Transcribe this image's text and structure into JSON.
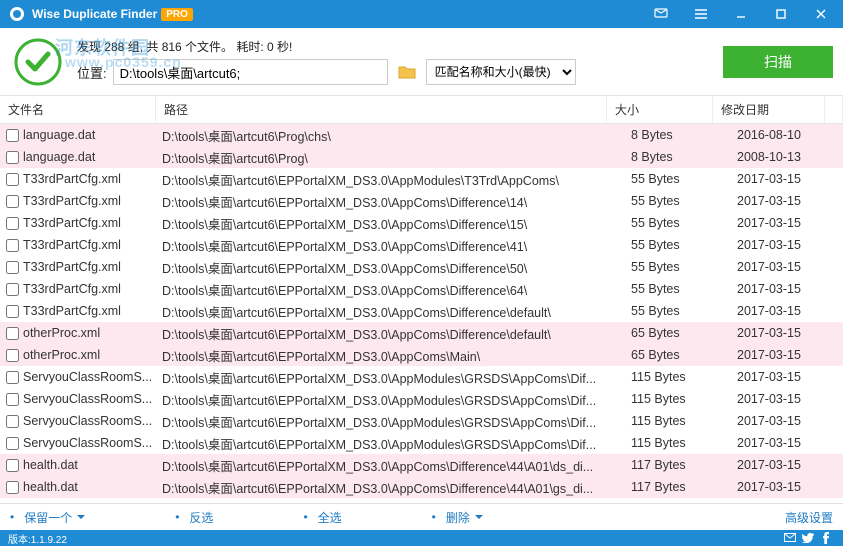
{
  "app": {
    "title": "Wise Duplicate Finder",
    "pro": "PRO"
  },
  "header": {
    "status": "发现 288 组, 共 816 个文件。 耗时: 0 秒!",
    "watermark1": "河东软件园",
    "watermark2": "www.pc0359.cn",
    "loc_label": "位置:",
    "loc_value": "D:\\tools\\桌面\\artcut6;",
    "match_mode": "匹配名称和大小(最快)",
    "scan": "扫描"
  },
  "columns": {
    "name": "文件名",
    "path": "路径",
    "size": "大小",
    "date": "修改日期"
  },
  "rows": [
    {
      "alt": true,
      "name": "language.dat",
      "path": "D:\\tools\\桌面\\artcut6\\Prog\\chs\\",
      "size": "8 Bytes",
      "date": "2016-08-10"
    },
    {
      "alt": true,
      "name": "language.dat",
      "path": "D:\\tools\\桌面\\artcut6\\Prog\\",
      "size": "8 Bytes",
      "date": "2008-10-13"
    },
    {
      "alt": false,
      "name": "T33rdPartCfg.xml",
      "path": "D:\\tools\\桌面\\artcut6\\EPPortalXM_DS3.0\\AppModules\\T3Trd\\AppComs\\",
      "size": "55 Bytes",
      "date": "2017-03-15"
    },
    {
      "alt": false,
      "name": "T33rdPartCfg.xml",
      "path": "D:\\tools\\桌面\\artcut6\\EPPortalXM_DS3.0\\AppComs\\Difference\\14\\",
      "size": "55 Bytes",
      "date": "2017-03-15"
    },
    {
      "alt": false,
      "name": "T33rdPartCfg.xml",
      "path": "D:\\tools\\桌面\\artcut6\\EPPortalXM_DS3.0\\AppComs\\Difference\\15\\",
      "size": "55 Bytes",
      "date": "2017-03-15"
    },
    {
      "alt": false,
      "name": "T33rdPartCfg.xml",
      "path": "D:\\tools\\桌面\\artcut6\\EPPortalXM_DS3.0\\AppComs\\Difference\\41\\",
      "size": "55 Bytes",
      "date": "2017-03-15"
    },
    {
      "alt": false,
      "name": "T33rdPartCfg.xml",
      "path": "D:\\tools\\桌面\\artcut6\\EPPortalXM_DS3.0\\AppComs\\Difference\\50\\",
      "size": "55 Bytes",
      "date": "2017-03-15"
    },
    {
      "alt": false,
      "name": "T33rdPartCfg.xml",
      "path": "D:\\tools\\桌面\\artcut6\\EPPortalXM_DS3.0\\AppComs\\Difference\\64\\",
      "size": "55 Bytes",
      "date": "2017-03-15"
    },
    {
      "alt": false,
      "name": "T33rdPartCfg.xml",
      "path": "D:\\tools\\桌面\\artcut6\\EPPortalXM_DS3.0\\AppComs\\Difference\\default\\",
      "size": "55 Bytes",
      "date": "2017-03-15"
    },
    {
      "alt": true,
      "name": "otherProc.xml",
      "path": "D:\\tools\\桌面\\artcut6\\EPPortalXM_DS3.0\\AppComs\\Difference\\default\\",
      "size": "65 Bytes",
      "date": "2017-03-15"
    },
    {
      "alt": true,
      "name": "otherProc.xml",
      "path": "D:\\tools\\桌面\\artcut6\\EPPortalXM_DS3.0\\AppComs\\Main\\",
      "size": "65 Bytes",
      "date": "2017-03-15"
    },
    {
      "alt": false,
      "name": "ServyouClassRoomS...",
      "path": "D:\\tools\\桌面\\artcut6\\EPPortalXM_DS3.0\\AppModules\\GRSDS\\AppComs\\Dif...",
      "size": "115 Bytes",
      "date": "2017-03-15"
    },
    {
      "alt": false,
      "name": "ServyouClassRoomS...",
      "path": "D:\\tools\\桌面\\artcut6\\EPPortalXM_DS3.0\\AppModules\\GRSDS\\AppComs\\Dif...",
      "size": "115 Bytes",
      "date": "2017-03-15"
    },
    {
      "alt": false,
      "name": "ServyouClassRoomS...",
      "path": "D:\\tools\\桌面\\artcut6\\EPPortalXM_DS3.0\\AppModules\\GRSDS\\AppComs\\Dif...",
      "size": "115 Bytes",
      "date": "2017-03-15"
    },
    {
      "alt": false,
      "name": "ServyouClassRoomS...",
      "path": "D:\\tools\\桌面\\artcut6\\EPPortalXM_DS3.0\\AppModules\\GRSDS\\AppComs\\Dif...",
      "size": "115 Bytes",
      "date": "2017-03-15"
    },
    {
      "alt": true,
      "name": "health.dat",
      "path": "D:\\tools\\桌面\\artcut6\\EPPortalXM_DS3.0\\AppComs\\Difference\\44\\A01\\ds_di...",
      "size": "117 Bytes",
      "date": "2017-03-15"
    },
    {
      "alt": true,
      "name": "health.dat",
      "path": "D:\\tools\\桌面\\artcut6\\EPPortalXM_DS3.0\\AppComs\\Difference\\44\\A01\\gs_di...",
      "size": "117 Bytes",
      "date": "2017-03-15"
    }
  ],
  "toolbar": {
    "keep": "保留一个",
    "invert": "反选",
    "selectall": "全选",
    "delete": "删除",
    "advanced": "高级设置"
  },
  "status": {
    "version": "版本:1.1.9.22"
  }
}
